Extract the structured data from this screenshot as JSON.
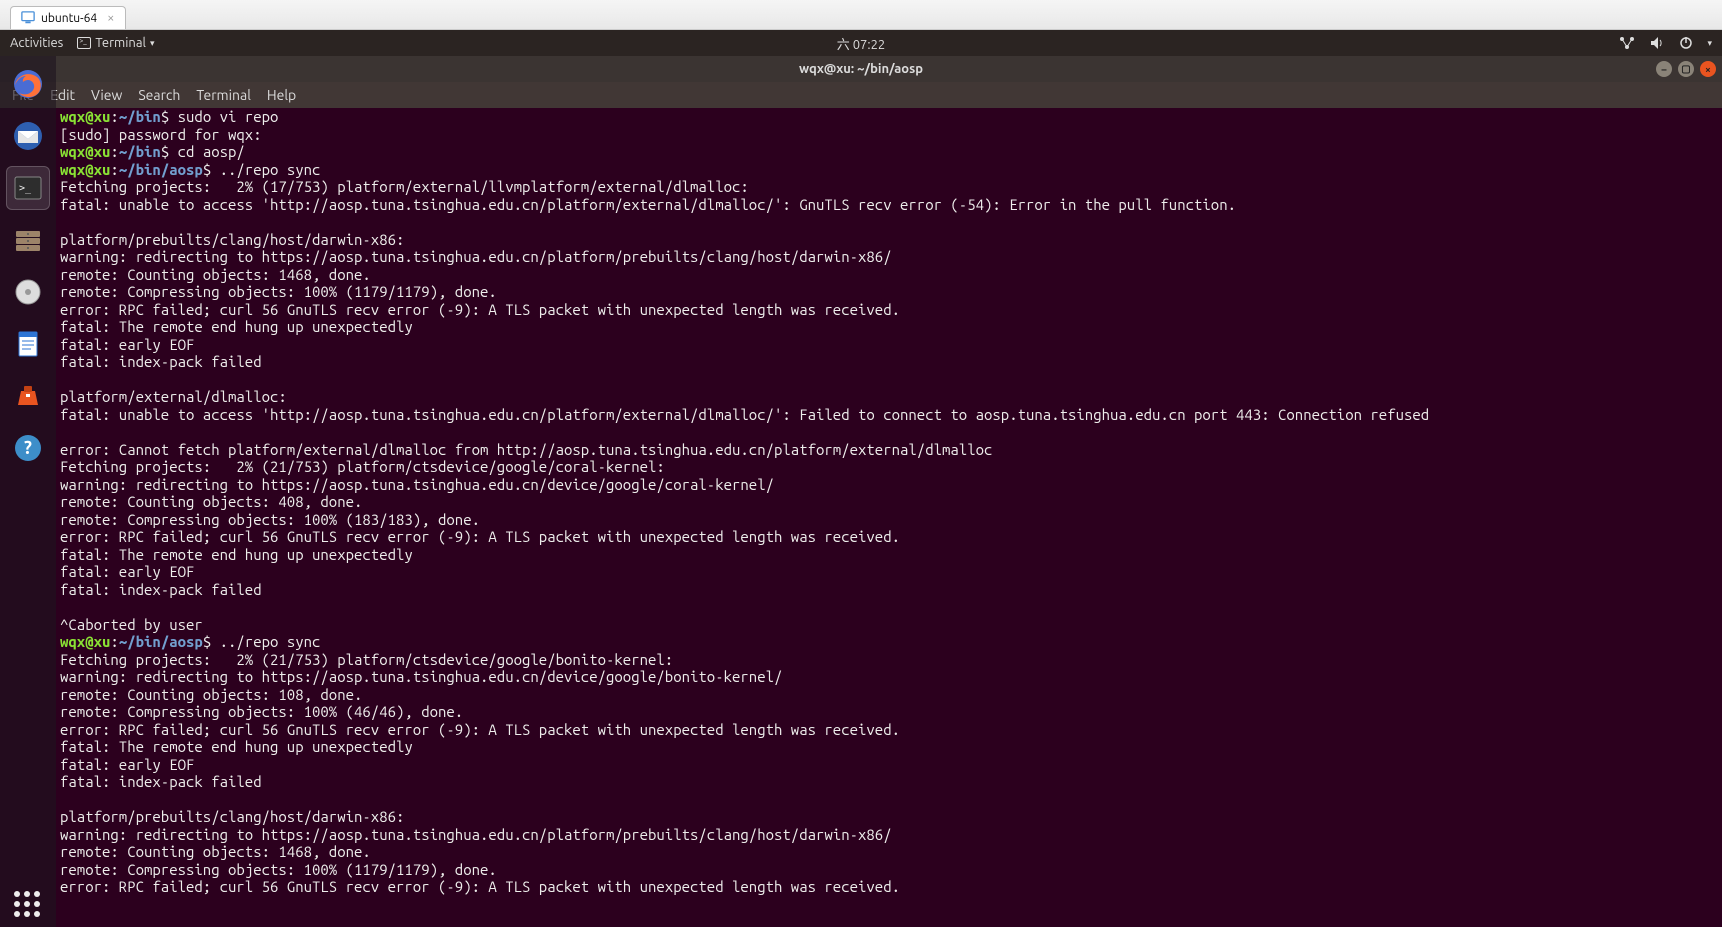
{
  "vm": {
    "tab_label": "ubuntu-64"
  },
  "topbar": {
    "activities": "Activities",
    "app_label": "Terminal",
    "clock": "六 07:22"
  },
  "window": {
    "title": "wqx@xu: ~/bin/aosp"
  },
  "menubar": {
    "file": "File",
    "edit": "Edit",
    "view": "View",
    "search": "Search",
    "terminal": "Terminal",
    "help": "Help"
  },
  "prompt": {
    "user_host": "wqx@xu",
    "sep": ":",
    "path_bin": "~/bin",
    "path_aosp": "~/bin/aosp",
    "dollar": "$"
  },
  "cmds": {
    "sudo_vi_repo": " sudo vi repo",
    "cd_aosp": " cd aosp/",
    "repo_sync": " ../repo sync"
  },
  "lines": {
    "sudo_pw": "[sudo] password for wqx:",
    "fetch1": "Fetching projects:   2% (17/753) platform/external/llvmplatform/external/dlmalloc:",
    "fatal_access1": "fatal: unable to access 'http://aosp.tuna.tsinghua.edu.cn/platform/external/dlmalloc/': GnuTLS recv error (-54): Error in the pull function.",
    "clang_hdr": "platform/prebuilts/clang/host/darwin-x86:",
    "redir_clang": "warning: redirecting to https://aosp.tuna.tsinghua.edu.cn/platform/prebuilts/clang/host/darwin-x86/",
    "count1468": "remote: Counting objects: 1468, done.",
    "comp1179": "remote: Compressing objects: 100% (1179/1179), done.",
    "rpc_err": "error: RPC failed; curl 56 GnuTLS recv error (-9): A TLS packet with unexpected length was received.",
    "hungup": "fatal: The remote end hung up unexpectedly",
    "early_eof": "fatal: early EOF",
    "idx_fail": "fatal: index-pack failed",
    "dlmalloc_hdr": "platform/external/dlmalloc:",
    "fatal_access2": "fatal: unable to access 'http://aosp.tuna.tsinghua.edu.cn/platform/external/dlmalloc/': Failed to connect to aosp.tuna.tsinghua.edu.cn port 443: Connection refused",
    "cannot_fetch": "error: Cannot fetch platform/external/dlmalloc from http://aosp.tuna.tsinghua.edu.cn/platform/external/dlmalloc",
    "fetch_coral": "Fetching projects:   2% (21/753) platform/ctsdevice/google/coral-kernel:",
    "redir_coral": "warning: redirecting to https://aosp.tuna.tsinghua.edu.cn/device/google/coral-kernel/",
    "count408": "remote: Counting objects: 408, done.",
    "comp183": "remote: Compressing objects: 100% (183/183), done.",
    "aborted": "^Caborted by user",
    "fetch_bonito": "Fetching projects:   2% (21/753) platform/ctsdevice/google/bonito-kernel:",
    "redir_bonito": "warning: redirecting to https://aosp.tuna.tsinghua.edu.cn/device/google/bonito-kernel/",
    "count108": "remote: Counting objects: 108, done.",
    "comp46": "remote: Compressing objects: 100% (46/46), done."
  }
}
